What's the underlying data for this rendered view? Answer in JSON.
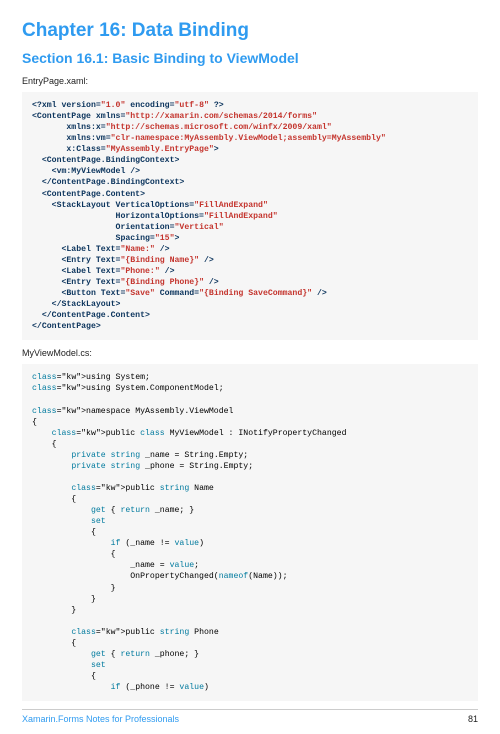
{
  "chapter_title": "Chapter 16: Data Binding",
  "section_title": "Section 16.1: Basic Binding to ViewModel",
  "label_entrypage": "EntryPage.xaml:",
  "label_viewmodel": "MyViewModel.cs:",
  "footer_text": "Xamarin.Forms Notes for Professionals",
  "page_number": "81",
  "code_xaml": "<?xml version=\"1.0\" encoding=\"utf-8\" ?>\n<ContentPage xmlns=\"http://xamarin.com/schemas/2014/forms\"\n       xmlns:x=\"http://schemas.microsoft.com/winfx/2009/xaml\"\n       xmlns:vm=\"clr-namespace:MyAssembly.ViewModel;assembly=MyAssembly\"\n       x:Class=\"MyAssembly.EntryPage\">\n  <ContentPage.BindingContext>\n    <vm:MyViewModel />\n  </ContentPage.BindingContext>\n  <ContentPage.Content>\n    <StackLayout VerticalOptions=\"FillAndExpand\"\n                 HorizontalOptions=\"FillAndExpand\"\n                 Orientation=\"Vertical\"\n                 Spacing=\"15\">\n      <Label Text=\"Name:\" />\n      <Entry Text=\"{Binding Name}\" />\n      <Label Text=\"Phone:\" />\n      <Entry Text=\"{Binding Phone}\" />\n      <Button Text=\"Save\" Command=\"{Binding SaveCommand}\" />\n    </StackLayout>\n  </ContentPage.Content>\n</ContentPage>",
  "code_cs": "using System;\nusing System.ComponentModel;\n\nnamespace MyAssembly.ViewModel\n{\n    public class MyViewModel : INotifyPropertyChanged\n    {\n        private string _name = String.Empty;\n        private string _phone = String.Empty;\n\n        public string Name\n        {\n            get { return _name; }\n            set\n            {\n                if (_name != value)\n                {\n                    _name = value;\n                    OnPropertyChanged(nameof(Name));\n                }\n            }\n        }\n\n        public string Phone\n        {\n            get { return _phone; }\n            set\n            {\n                if (_phone != value)"
}
